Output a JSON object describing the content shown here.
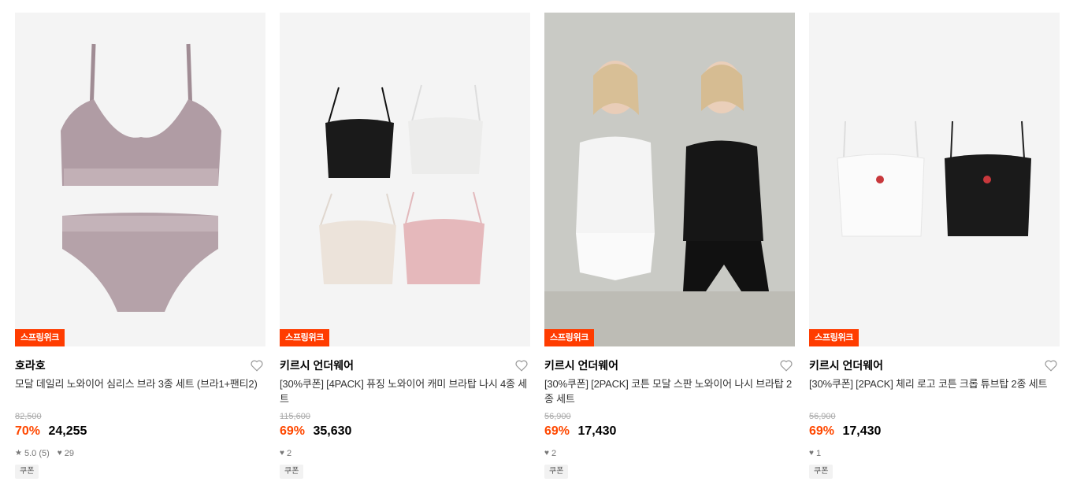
{
  "products": [
    {
      "badge": "스프링위크",
      "brand": "호라호",
      "title": "모달 데일리 노와이어 심리스 브라 3종 세트 (브라1+팬티2)",
      "original_price": "82,500",
      "discount": "70%",
      "price": "24,255",
      "rating": "5.0",
      "review_count": "(5)",
      "likes": "29",
      "coupon": "쿠폰"
    },
    {
      "badge": "스프링위크",
      "brand": "키르시 언더웨어",
      "title": "[30%쿠폰] [4PACK] 퓨징 노와이어 캐미 브라탑 나시 4종 세트",
      "original_price": "115,600",
      "discount": "69%",
      "price": "35,630",
      "likes": "2",
      "coupon": "쿠폰"
    },
    {
      "badge": "스프링위크",
      "brand": "키르시 언더웨어",
      "title": "[30%쿠폰] [2PACK] 코튼 모달 스판 노와이어 나시 브라탑 2종 세트",
      "original_price": "56,900",
      "discount": "69%",
      "price": "17,430",
      "likes": "2",
      "coupon": "쿠폰"
    },
    {
      "badge": "스프링위크",
      "brand": "키르시 언더웨어",
      "title": "[30%쿠폰] [2PACK] 체리 로고 코튼 크롭 튜브탑 2종 세트",
      "original_price": "56,900",
      "discount": "69%",
      "price": "17,430",
      "likes": "1",
      "coupon": "쿠폰"
    }
  ]
}
